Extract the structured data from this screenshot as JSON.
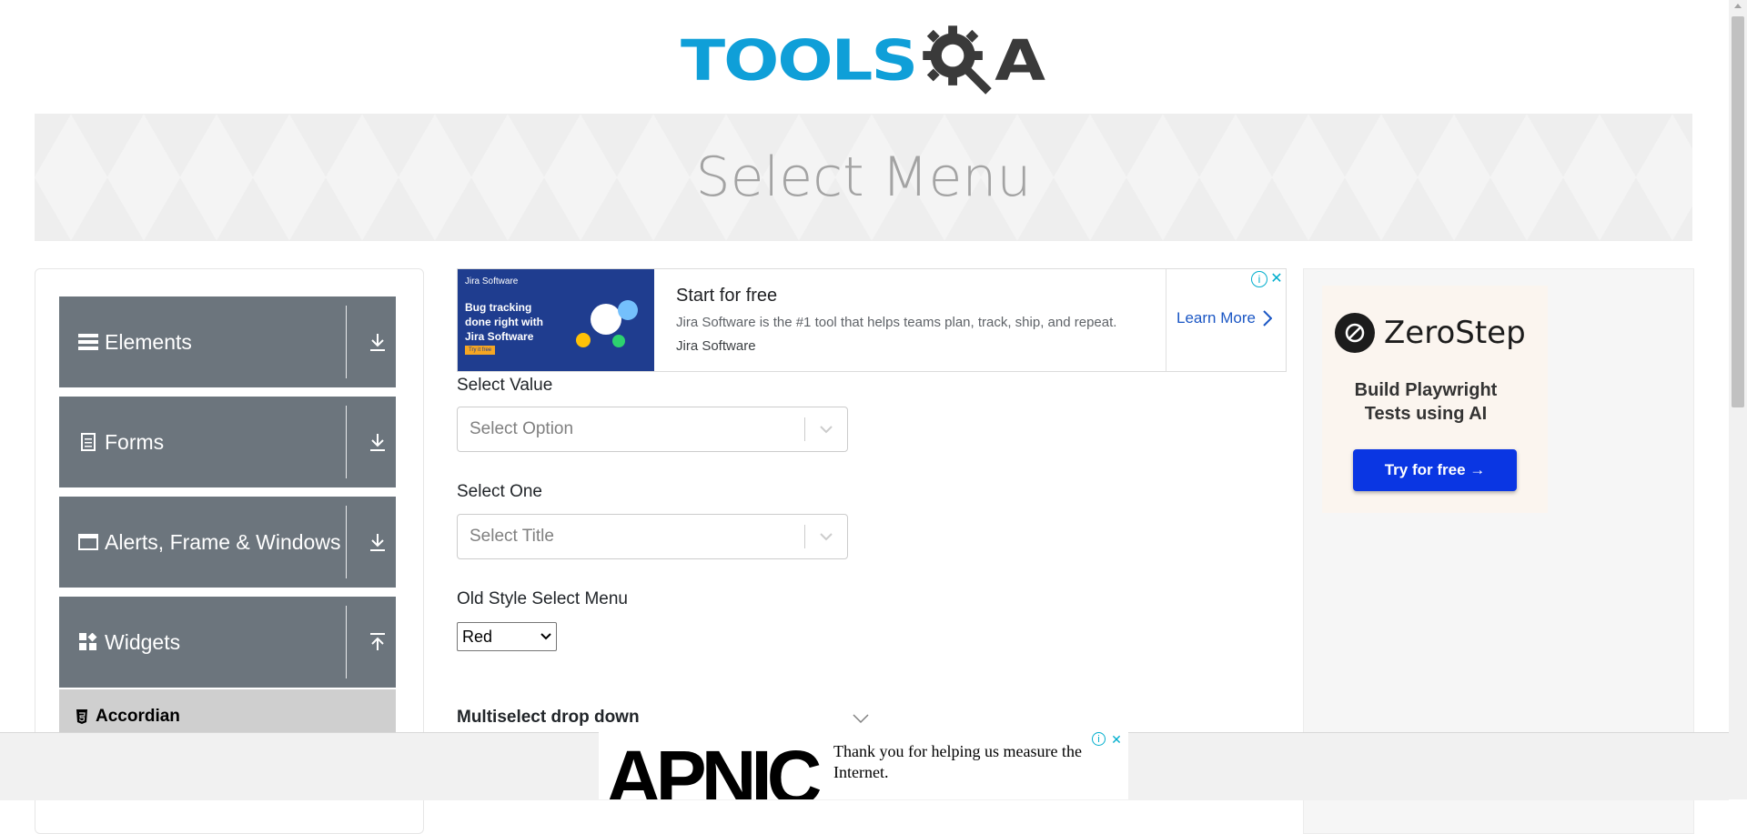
{
  "header": {
    "logo_part1": "TOOLS",
    "logo_part2": "A"
  },
  "banner": {
    "title": "Select Menu"
  },
  "sidebar": {
    "groups": [
      {
        "label": "Elements",
        "icon": "bars-icon",
        "arrow": "download-icon"
      },
      {
        "label": "Forms",
        "icon": "document-icon",
        "arrow": "download-icon"
      },
      {
        "label": "Alerts, Frame & Windows",
        "icon": "window-icon",
        "arrow": "download-icon"
      },
      {
        "label": "Widgets",
        "icon": "grid-icon",
        "arrow": "upload-icon"
      }
    ],
    "active_item": {
      "label": "Accordian",
      "icon": "html5-icon"
    }
  },
  "top_ad": {
    "image_brand": "Jira Software",
    "image_tagline": "Bug tracking done right with Jira Software",
    "image_cta": "Try it free",
    "headline": "Start for free",
    "body": "Jira Software is the #1 tool that helps teams plan, track, ship, and repeat.",
    "source": "Jira Software",
    "cta": "Learn More"
  },
  "form": {
    "select_value": {
      "label": "Select Value",
      "placeholder": "Select Option"
    },
    "select_one": {
      "label": "Select One",
      "placeholder": "Select Title"
    },
    "old_style": {
      "label": "Old Style Select Menu",
      "value": "Red"
    },
    "multiselect": {
      "label": "Multiselect drop down"
    }
  },
  "right_ad": {
    "brand": "ZeroStep",
    "tagline": "Build Playwright Tests using AI",
    "button": "Try for free →"
  },
  "bottom_ad": {
    "logo": "APNIC",
    "text": "Thank you for helping us measure the Internet."
  },
  "colors": {
    "logo_blue": "#0f9fd8",
    "logo_dark": "#3a3a3a",
    "sidebar_gray": "#6c757d",
    "zerostep_button": "#0a36e3",
    "link_blue": "#1a56c4"
  }
}
